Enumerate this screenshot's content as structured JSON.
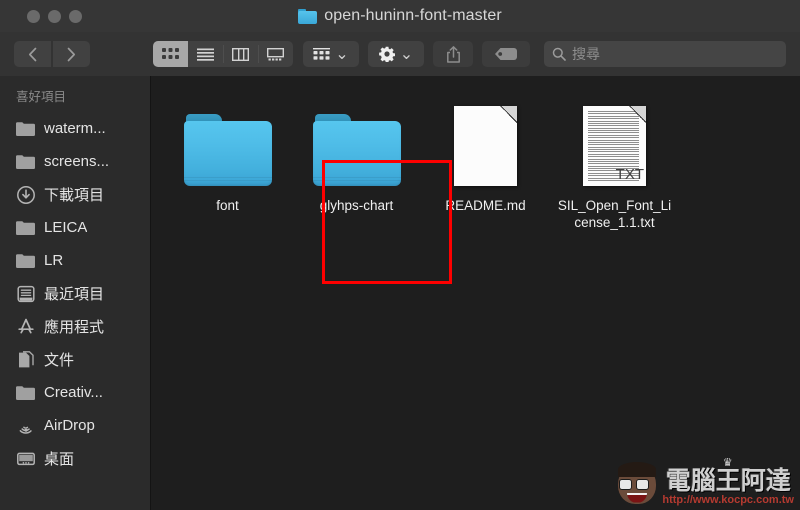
{
  "window": {
    "title": "open-huninn-font-master",
    "traffic_lights": [
      "close-button",
      "minimize-button",
      "zoom-button"
    ]
  },
  "toolbar": {
    "back_label": "‹",
    "forward_label": "›",
    "view_buttons": [
      {
        "name": "icon-view-button",
        "active": true
      },
      {
        "name": "list-view-button",
        "active": false
      },
      {
        "name": "column-view-button",
        "active": false
      },
      {
        "name": "gallery-view-button",
        "active": false
      }
    ],
    "arrange_label": "arrange-button",
    "action_label": "action-gear-button",
    "share_label": "share-button",
    "tag_label": "tag-button",
    "chevron": "⌄"
  },
  "search": {
    "placeholder": "搜尋",
    "value": ""
  },
  "sidebar": {
    "header": "喜好項目",
    "items": [
      {
        "label": "waterm...",
        "icon": "folder-icon"
      },
      {
        "label": "screens...",
        "icon": "folder-icon"
      },
      {
        "label": "下載項目",
        "icon": "downloads-icon"
      },
      {
        "label": "LEICA",
        "icon": "folder-icon"
      },
      {
        "label": "LR",
        "icon": "folder-icon"
      },
      {
        "label": "最近項目",
        "icon": "recents-icon"
      },
      {
        "label": "應用程式",
        "icon": "applications-icon"
      },
      {
        "label": "文件",
        "icon": "documents-icon"
      },
      {
        "label": "Creativ...",
        "icon": "folder-icon"
      },
      {
        "label": "AirDrop",
        "icon": "airdrop-icon"
      },
      {
        "label": "桌面",
        "icon": "desktop-icon"
      }
    ]
  },
  "content": {
    "items": [
      {
        "label": "font",
        "kind": "folder",
        "highlighted": true
      },
      {
        "label": "glyhps-chart",
        "kind": "folder",
        "highlighted": false
      },
      {
        "label": "README.md",
        "kind": "document-blank",
        "highlighted": false
      },
      {
        "label": "SIL_Open_Font_License_1.1.txt",
        "kind": "document-txt",
        "badge": "TXT",
        "highlighted": false
      }
    ]
  },
  "annotation": {
    "color": "#fe0000",
    "target": "font"
  },
  "watermark": {
    "text": "電腦王阿達",
    "url": "http://www.kocpc.com.tw",
    "crown": "♛"
  },
  "colors": {
    "titlebar": "#363636",
    "toolbar": "#333333",
    "sidebar": "#2b2b2b",
    "content": "#1e1e1e",
    "folder_top": "#56c6ee",
    "folder_bottom": "#3aa3d4",
    "annotation": "#fe0000"
  }
}
